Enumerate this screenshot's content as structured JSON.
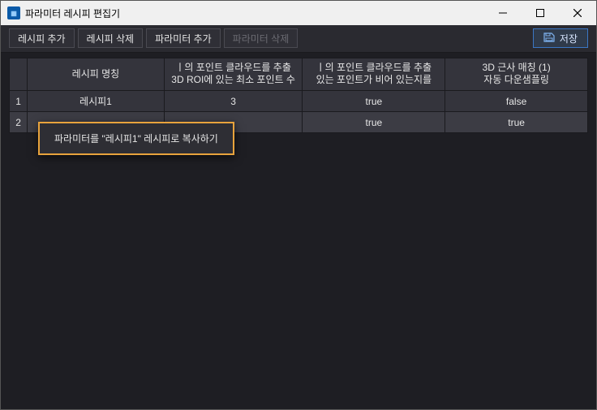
{
  "titlebar": {
    "app_title": "파라미터 레시피 편집기"
  },
  "toolbar": {
    "add_recipe": "레시피 추가",
    "delete_recipe": "레시피 삭제",
    "add_param": "파라미터 추가",
    "delete_param": "파라미터 삭제",
    "save": "저장"
  },
  "table": {
    "headers": {
      "recipe_name": "레시피 명칭",
      "col1": "ㅣ의 포인트 클라우드를 추출\n3D ROI에 있는 최소 포인트 수",
      "col2": "ㅣ의 포인트 클라우드를 추출\n있는 포인트가 비어 있는지를",
      "col3": "3D 근사 매칭 (1)\n자동 다운샘플링"
    },
    "rows": [
      {
        "num": "1",
        "name": "레시피1",
        "c1": "3",
        "c2": "true",
        "c3": "false"
      },
      {
        "num": "2",
        "name": "",
        "c1": "",
        "c2": "true",
        "c3": "true"
      }
    ]
  },
  "context_menu": {
    "copy_to": "파라미터를 \"레시피1\" 레시피로 복사하기"
  }
}
